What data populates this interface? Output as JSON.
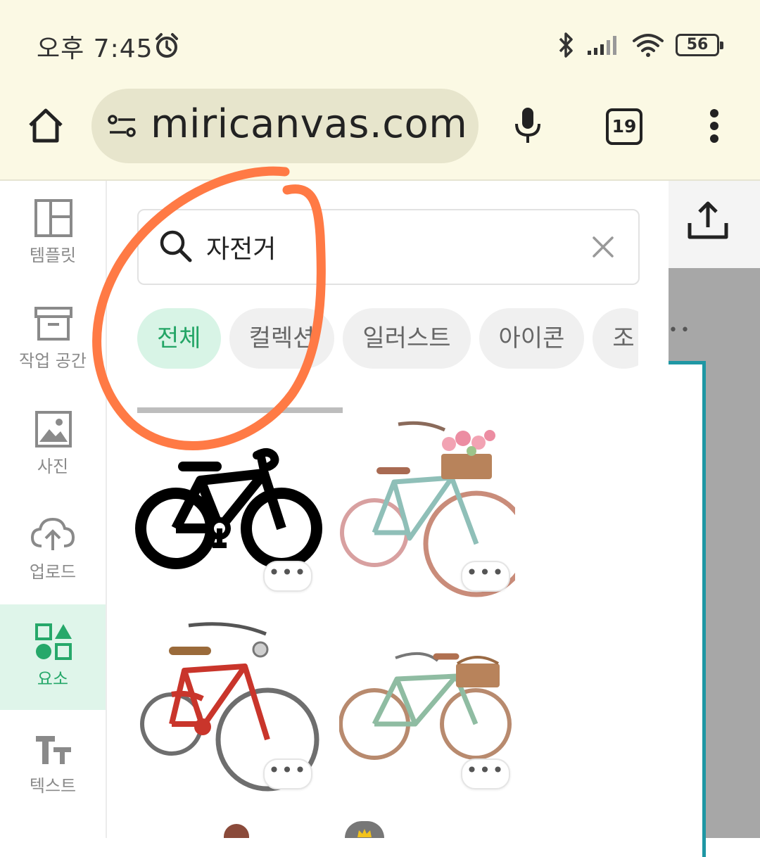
{
  "status_bar": {
    "time": "오후 7:45",
    "battery": "56"
  },
  "browser": {
    "url": "miricanvas.com",
    "tab_count": "19"
  },
  "left_nav": {
    "items": [
      {
        "label": "템플릿",
        "icon": "template-icon"
      },
      {
        "label": "작업 공간",
        "icon": "archive-icon"
      },
      {
        "label": "사진",
        "icon": "photo-icon"
      },
      {
        "label": "업로드",
        "icon": "upload-cloud-icon"
      },
      {
        "label": "요소",
        "icon": "elements-icon",
        "active": true
      },
      {
        "label": "텍스트",
        "icon": "text-icon"
      }
    ]
  },
  "panel": {
    "search": {
      "value": "자전거"
    },
    "chips": [
      "전체",
      "컬렉션",
      "일러스트",
      "아이콘",
      "조"
    ],
    "more_label": "•••",
    "results": [
      "bicycle-silhouette-icon",
      "vintage-blue-bicycle-with-flower-basket",
      "red-vintage-bicycle",
      "green-bicycle-with-basket"
    ]
  },
  "colors": {
    "accent": "#23a566",
    "accent_bg": "#dff5ea",
    "annotation": "#ff7a45",
    "browser_bg": "#fbf9e4"
  }
}
